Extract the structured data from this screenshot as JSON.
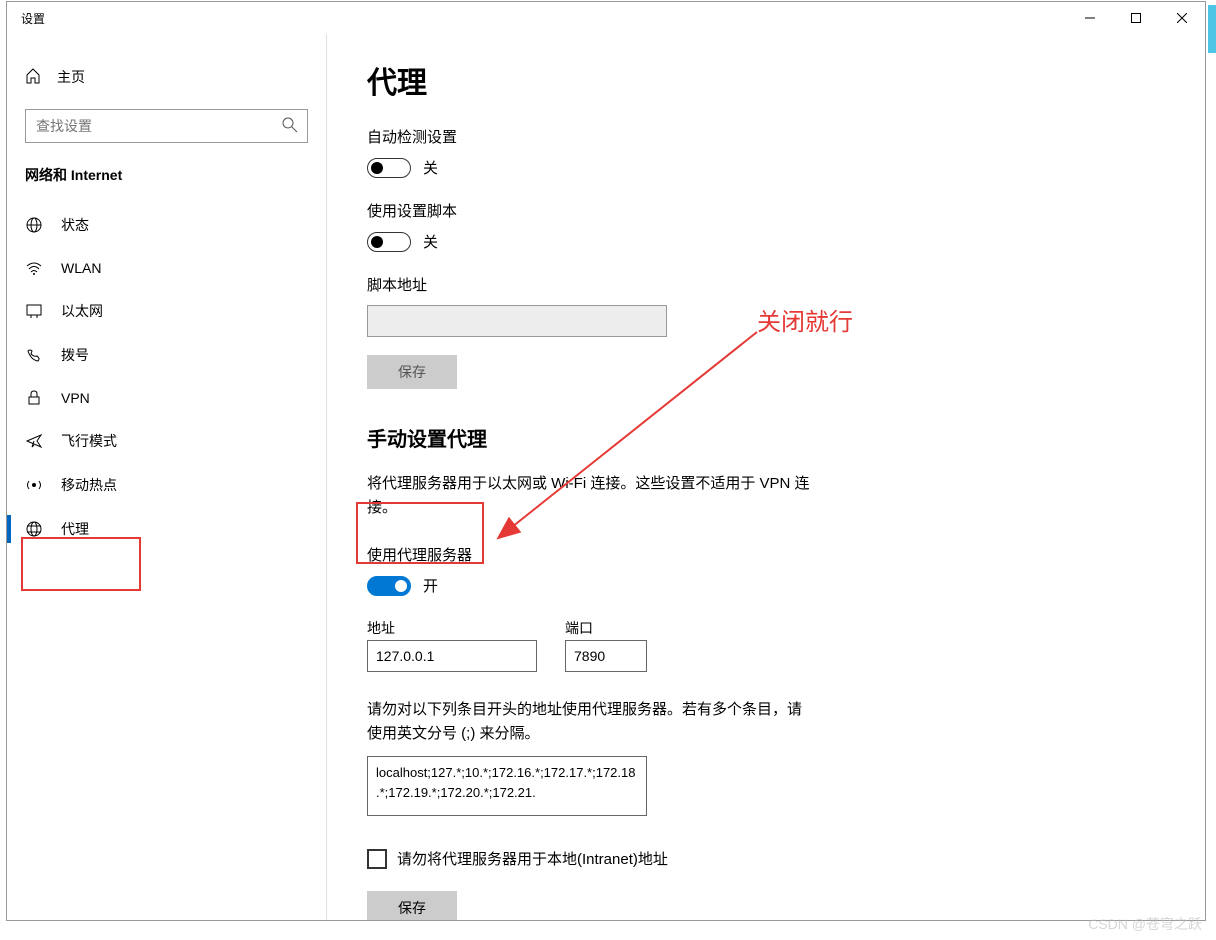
{
  "window": {
    "title": "设置"
  },
  "sidebar": {
    "home": "主页",
    "search_placeholder": "查找设置",
    "group": "网络和 Internet",
    "items": [
      {
        "label": "状态"
      },
      {
        "label": "WLAN"
      },
      {
        "label": "以太网"
      },
      {
        "label": "拨号"
      },
      {
        "label": "VPN"
      },
      {
        "label": "飞行模式"
      },
      {
        "label": "移动热点"
      },
      {
        "label": "代理"
      }
    ]
  },
  "main": {
    "title": "代理",
    "auto_detect": {
      "label": "自动检测设置",
      "state": "关"
    },
    "use_script": {
      "label": "使用设置脚本",
      "state": "关"
    },
    "script_addr_label": "脚本地址",
    "script_addr_value": "",
    "save": "保存",
    "manual_header": "手动设置代理",
    "manual_desc": "将代理服务器用于以太网或 Wi-Fi 连接。这些设置不适用于 VPN 连接。",
    "use_proxy": {
      "label": "使用代理服务器",
      "state": "开"
    },
    "addr_label": "地址",
    "addr_value": "127.0.0.1",
    "port_label": "端口",
    "port_value": "7890",
    "except_desc": "请勿对以下列条目开头的地址使用代理服务器。若有多个条目，请使用英文分号 (;) 来分隔。",
    "except_value": "localhost;127.*;10.*;172.16.*;172.17.*;172.18.*;172.19.*;172.20.*;172.21.",
    "intranet_label": "请勿将代理服务器用于本地(Intranet)地址",
    "save2": "保存"
  },
  "annotation": {
    "text": "关闭就行"
  },
  "watermark": "CSDN @苍穹之跃"
}
